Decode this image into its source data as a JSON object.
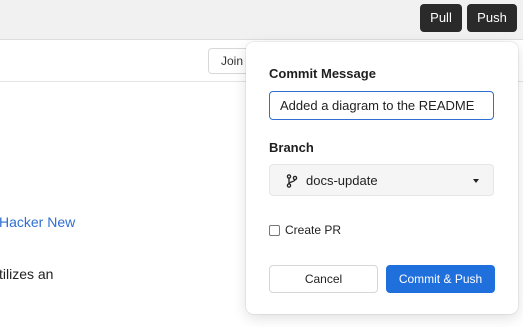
{
  "toolbar": {
    "pull_label": "Pull",
    "push_label": "Push"
  },
  "subbar": {
    "join_label": "Join"
  },
  "background": {
    "link_text": "Hacker New",
    "body_text": "tilizes an"
  },
  "popover": {
    "commit_message_label": "Commit Message",
    "commit_message_value": "Added a diagram to the README",
    "branch_label": "Branch",
    "branch_value": "docs-update",
    "branch_icon": "git-branch-icon",
    "create_pr_label": "Create PR",
    "create_pr_checked": false,
    "cancel_label": "Cancel",
    "commit_push_label": "Commit & Push"
  },
  "colors": {
    "accent": "#1f6fdc",
    "dark_button": "#2a2a2a",
    "link": "#2f6fd1"
  }
}
